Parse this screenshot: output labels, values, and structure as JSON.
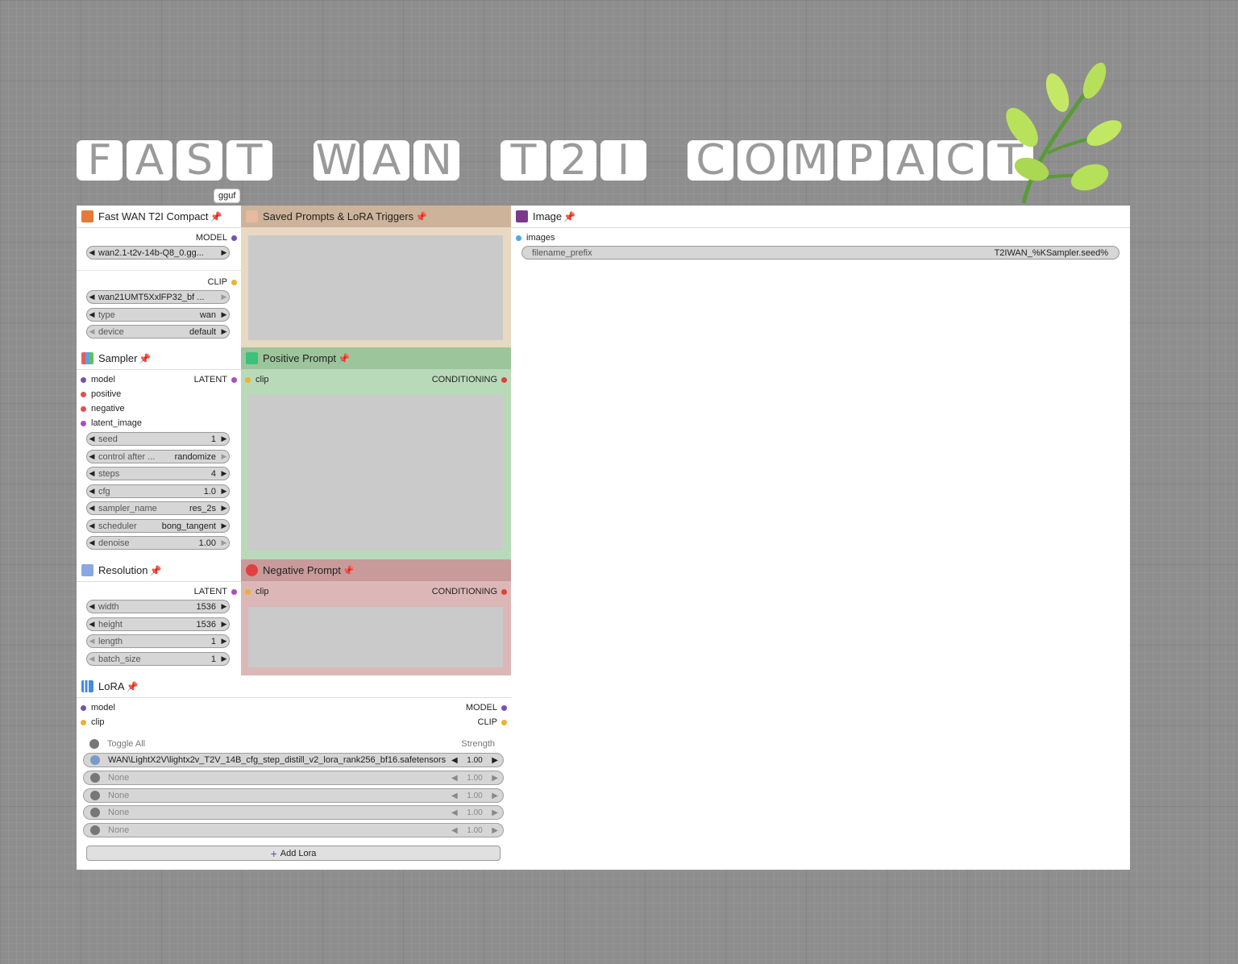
{
  "title_tiles": [
    "F",
    "A",
    "S",
    "T",
    " ",
    "W",
    "A",
    "N",
    " ",
    "T",
    "2",
    "I",
    " ",
    "C",
    "O",
    "M",
    "P",
    "A",
    "C",
    "T"
  ],
  "badge": "gguf",
  "panels": {
    "fast": {
      "title": "Fast WAN T2I Compact",
      "out_model": "MODEL",
      "model_file": "wan2.1-t2v-14b-Q8_0.gg...",
      "out_clip": "CLIP",
      "clip_file": "wan21UMT5XxlFP32_bf ...",
      "type_label": "type",
      "type_value": "wan",
      "device_label": "device",
      "device_value": "default"
    },
    "saved": {
      "title": "Saved Prompts & LoRA Triggers"
    },
    "image": {
      "title": "Image",
      "in_images": "images",
      "prefix_label": "filename_prefix",
      "prefix_value": "T2IWAN_%KSampler.seed%"
    },
    "sampler": {
      "title": "Sampler",
      "in_model": "model",
      "in_positive": "positive",
      "in_negative": "negative",
      "in_latent": "latent_image",
      "out_latent": "LATENT",
      "widgets": [
        {
          "label": "seed",
          "value": "1"
        },
        {
          "label": "control after ...",
          "value": "randomize"
        },
        {
          "label": "steps",
          "value": "4"
        },
        {
          "label": "cfg",
          "value": "1.0"
        },
        {
          "label": "sampler_name",
          "value": "res_2s"
        },
        {
          "label": "scheduler",
          "value": "bong_tangent"
        },
        {
          "label": "denoise",
          "value": "1.00"
        }
      ]
    },
    "positive": {
      "title": "Positive Prompt",
      "in_clip": "clip",
      "out": "CONDITIONING"
    },
    "resolution": {
      "title": "Resolution",
      "out_latent": "LATENT",
      "widgets": [
        {
          "label": "width",
          "value": "1536"
        },
        {
          "label": "height",
          "value": "1536"
        },
        {
          "label": "length",
          "value": "1"
        },
        {
          "label": "batch_size",
          "value": "1"
        }
      ]
    },
    "negative": {
      "title": "Negative Prompt",
      "in_clip": "clip",
      "out": "CONDITIONING"
    },
    "lora": {
      "title": "LoRA",
      "in_model": "model",
      "in_clip": "clip",
      "out_model": "MODEL",
      "out_clip": "CLIP",
      "toggle_all": "Toggle All",
      "strength_header": "Strength",
      "rows": [
        {
          "name": "WAN\\LightX2V\\lightx2v_T2V_14B_cfg_step_distill_v2_lora_rank256_bf16.safetensors",
          "strength": "1.00"
        },
        {
          "name": "None",
          "strength": "1.00"
        },
        {
          "name": "None",
          "strength": "1.00"
        },
        {
          "name": "None",
          "strength": "1.00"
        },
        {
          "name": "None",
          "strength": "1.00"
        }
      ],
      "add_label": "Add Lora"
    }
  },
  "colors": {
    "model": "#7b4fb5",
    "clip": "#f0b030",
    "latent": "#a84fc0",
    "conditioning": "#e0403a",
    "positive": "#e05050",
    "images": "#4aa8e8"
  }
}
